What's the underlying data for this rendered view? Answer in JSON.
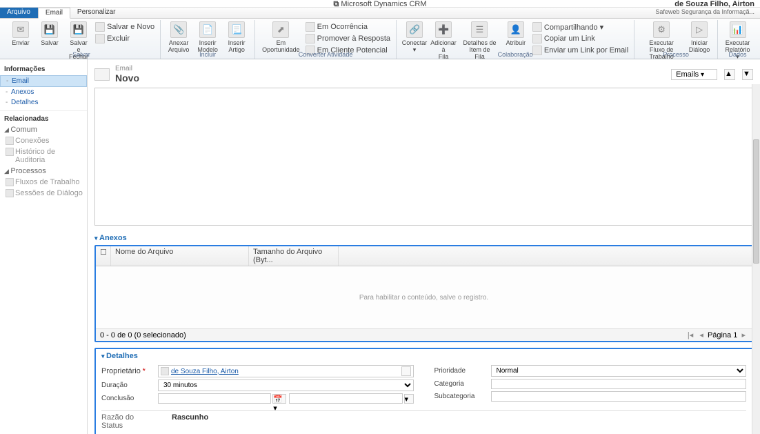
{
  "header": {
    "product": "Microsoft Dynamics CRM",
    "user": "de Souza Filho, Airton",
    "org": "Safeweb Segurança da Informaçã..."
  },
  "tabs": {
    "file": "Arquivo",
    "email": "Email",
    "custom": "Personalizar"
  },
  "ribbon": {
    "salvar": {
      "enviar": "Enviar",
      "salvar": "Salvar",
      "salvar_fechar": "Salvar e\nFechar",
      "salvar_novo": "Salvar e Novo",
      "excluir": "Excluir",
      "group": "Salvar"
    },
    "incluir": {
      "anexar": "Anexar\nArquivo",
      "inserir_modelo": "Inserir\nModelo",
      "inserir_artigo": "Inserir\nArtigo",
      "group": "Incluir"
    },
    "converter": {
      "em_oportunidade": "Em\nOportunidade",
      "em_ocorrencia": "Em Ocorrência",
      "promover_resposta": "Promover à Resposta",
      "em_cliente_potencial": "Em Cliente Potencial",
      "group": "Converter Atividade"
    },
    "colab": {
      "conectar": "Conectar\n▾",
      "adicionar_fila": "Adicionar à\nFila",
      "detalhes_fila": "Detalhes de Item de\nFila",
      "atribuir": "Atribuir",
      "compart": "Compartilhando ▾",
      "copiar_link": "Copiar um Link",
      "enviar_link": "Enviar um Link por Email",
      "group": "Colaboração"
    },
    "processo": {
      "fluxo": "Executar Fluxo de\nTrabalho",
      "dialogo": "Iniciar\nDiálogo",
      "group": "Processo"
    },
    "dados": {
      "relatorio": "Executar\nRelatório ▾",
      "group": "Dados"
    }
  },
  "nav": {
    "info": "Informações",
    "email": "Email",
    "anexos": "Anexos",
    "detalhes": "Detalhes",
    "related": "Relacionadas",
    "comum": "Comum",
    "conexoes": "Conexões",
    "auditoria": "Histórico de Auditoria",
    "processos": "Processos",
    "fluxos": "Fluxos de Trabalho",
    "sessoes": "Sessões de Diálogo"
  },
  "form": {
    "entity": "Email",
    "title": "Novo",
    "view_selector": "Emails"
  },
  "anexos": {
    "head": "Anexos",
    "col_nome": "Nome do Arquivo",
    "col_tam": "Tamanho do Arquivo (Byt...",
    "empty_msg": "Para habilitar o conteúdo, salve o registro.",
    "footer_count": "0 - 0 de 0 (0 selecionado)",
    "page": "Página 1"
  },
  "detalhes": {
    "head": "Detalhes",
    "proprietario_lbl": "Proprietário",
    "proprietario_val": "de Souza Filho, Airton",
    "duracao_lbl": "Duração",
    "duracao_val": "30 minutos",
    "conclusao_lbl": "Conclusão",
    "prioridade_lbl": "Prioridade",
    "prioridade_val": "Normal",
    "categoria_lbl": "Categoria",
    "subcategoria_lbl": "Subcategoria"
  },
  "status": {
    "lbl": "Razão do Status",
    "val": "Rascunho"
  }
}
